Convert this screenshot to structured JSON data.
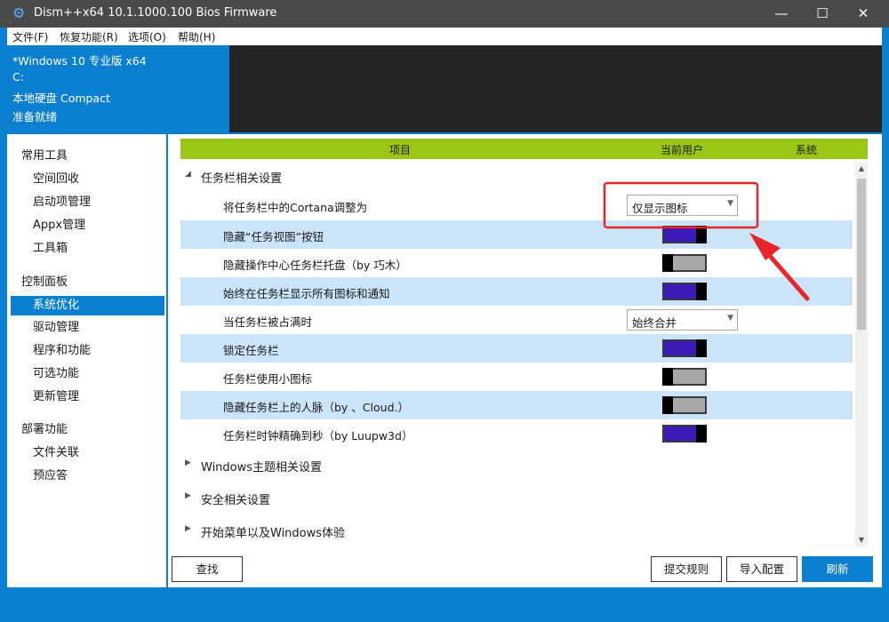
{
  "window": {
    "title": "Dism++x64 10.1.1000.100 Bios Firmware",
    "title_icon": "gear-icon",
    "controls": {
      "minimize": "—",
      "maximize": "☐",
      "close": "✕"
    }
  },
  "menu": [
    "文件(F)",
    "恢复功能(R)",
    "选项(O)",
    "帮助(H)"
  ],
  "info": {
    "os": "*Windows 10 专业版 x64",
    "drive": "C:",
    "disk": "本地硬盘 Compact",
    "status": "准备就绪"
  },
  "sidebar": {
    "groups": [
      {
        "label": "常用工具",
        "items": [
          "空间回收",
          "启动项管理",
          "Appx管理",
          "工具箱"
        ]
      },
      {
        "label": "控制面板",
        "items": [
          "系统优化",
          "驱动管理",
          "程序和功能",
          "可选功能",
          "更新管理"
        ]
      },
      {
        "label": "部署功能",
        "items": [
          "文件关联",
          "预应答"
        ]
      }
    ],
    "active_item": "系统优化"
  },
  "grid": {
    "headers": {
      "item": "项目",
      "current_user": "当前用户",
      "system": "系统"
    },
    "expanded_section": "任务栏相关设置",
    "rows": [
      {
        "label": "将任务栏中的Cortana调整为",
        "control": "dropdown",
        "value": "仅显示图标"
      },
      {
        "label": "隐藏“任务视图”按钮",
        "control": "toggle",
        "on": true
      },
      {
        "label": "隐藏操作中心任务栏托盘（by 巧木）",
        "control": "toggle",
        "on": false
      },
      {
        "label": "始终在任务栏显示所有图标和通知",
        "control": "toggle",
        "on": true
      },
      {
        "label": "当任务栏被占满时",
        "control": "dropdown",
        "value": "始终合并"
      },
      {
        "label": "锁定任务栏",
        "control": "toggle",
        "on": true
      },
      {
        "label": "任务栏使用小图标",
        "control": "toggle",
        "on": false
      },
      {
        "label": "隐藏任务栏上的人脉（by 、Cloud.）",
        "control": "toggle",
        "on": false
      },
      {
        "label": "任务栏时钟精确到秒（by Luupw3d）",
        "control": "toggle",
        "on": true
      }
    ],
    "collapsed_sections": [
      "Windows主题相关设置",
      "安全相关设置",
      "开始菜单以及Windows体验"
    ]
  },
  "buttons": {
    "find": "查找",
    "submit_rule": "提交规则",
    "import_config": "导入配置",
    "refresh": "刷新"
  },
  "colors": {
    "accent": "#0b7fd0",
    "header_green": "#9ac618",
    "toggle_on": "#3b1ab8",
    "highlight_box": "#e8252b"
  }
}
